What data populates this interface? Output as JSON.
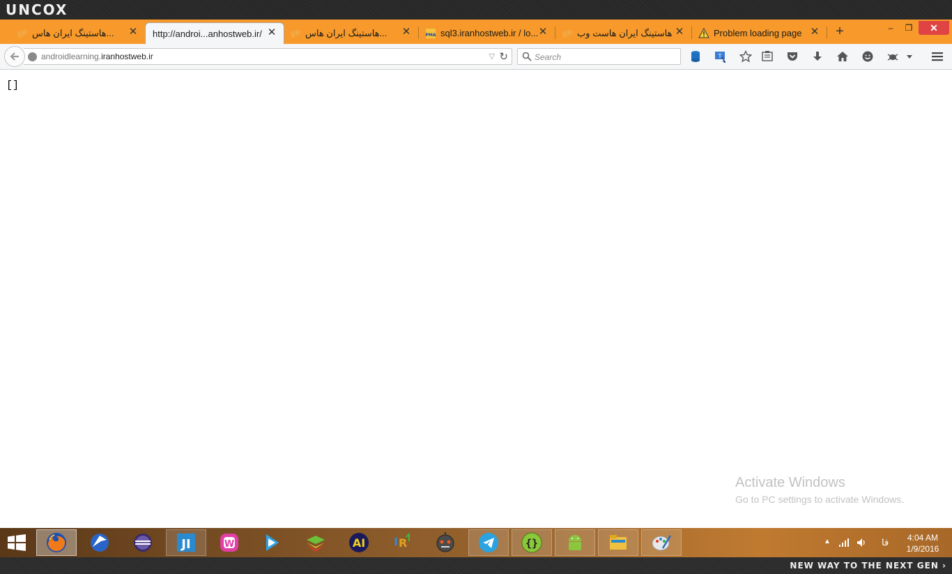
{
  "brand": {
    "logo_text": "UNCOX",
    "tagline": "NEW WAY TO THE NEXT GEN ›"
  },
  "tabs": [
    {
      "title": "هاستینگ ایران هاس...",
      "favicon": "gp-icon",
      "active": false
    },
    {
      "title": "http://androi...anhostweb.ir/",
      "favicon": "none",
      "active": true
    },
    {
      "title": "هاستینگ ایران هاس...",
      "favicon": "gp-icon",
      "active": false
    },
    {
      "title": "sql3.iranhostweb.ir / lo...",
      "favicon": "pma-icon",
      "active": false
    },
    {
      "title": "هاستینگ ایران هاست وب",
      "favicon": "gp-icon",
      "active": false
    },
    {
      "title": "Problem loading page",
      "favicon": "warning-icon",
      "active": false
    }
  ],
  "tab_close_glyph": "✕",
  "new_tab_glyph": "+",
  "window_controls": {
    "minimize": "–",
    "restore": "❐",
    "close": "✕"
  },
  "navbar": {
    "url_path": "androidlearning.",
    "url_domain": "iranhostweb.ir",
    "search_placeholder": "Search"
  },
  "page": {
    "body_text": "[]"
  },
  "watermark": {
    "title": "Activate Windows",
    "subtitle": "Go to PC settings to activate Windows."
  },
  "taskbar": {
    "apps": [
      "firefox-icon",
      "maxthon-icon",
      "eclipse-icon",
      "intellij-icon",
      "wamp-icon",
      "media-player-icon",
      "bluestacks-icon",
      "aimp-icon",
      "irmusic-icon",
      "bot-icon",
      "telegram-icon",
      "json-editor-icon",
      "android-icon",
      "file-explorer-icon",
      "paint-icon"
    ],
    "language": "فا",
    "time": "4:04 AM",
    "date": "1/9/2016"
  },
  "colors": {
    "tabstrip": "#f79a2b",
    "active_tab": "#f5f6f7",
    "close_button": "#e04343"
  }
}
